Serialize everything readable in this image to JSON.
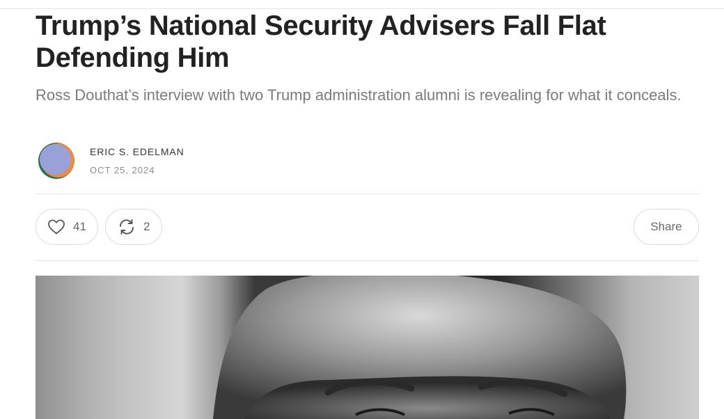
{
  "article": {
    "title": "Trump’s National Security Advisers Fall Flat Defending Him",
    "subtitle": "Ross Douthat’s interview with two Trump administration alumni is revealing for what it conceals.",
    "author": "ERIC S. EDELMAN",
    "date": "OCT 25, 2024"
  },
  "actions": {
    "like_count": "41",
    "restack_count": "2",
    "share_label": "Share"
  },
  "icons": {
    "like": "heart-icon",
    "restack": "restack-icon"
  },
  "colors": {
    "title": "#222222",
    "subtitle": "#7b7b7b",
    "avatar_orange": "#e98d45",
    "avatar_violet": "#9aa0d8",
    "avatar_green": "#2f6e4e"
  }
}
